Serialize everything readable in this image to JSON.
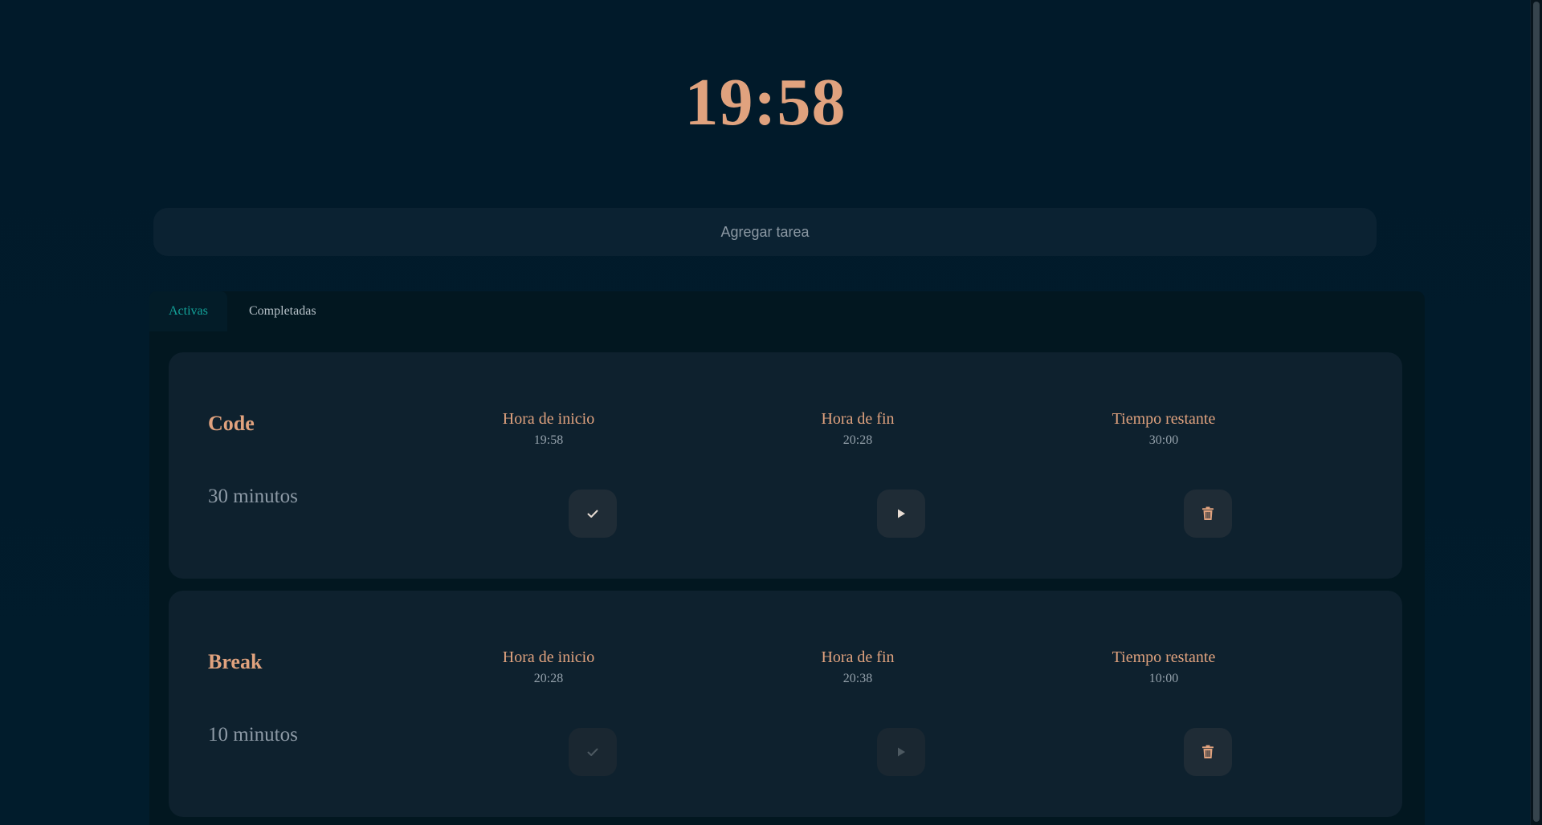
{
  "clock": "19:58",
  "add_task": {
    "placeholder": "Agregar tarea"
  },
  "tabs": [
    {
      "label": "Activas",
      "active": true
    },
    {
      "label": "Completadas",
      "active": false
    }
  ],
  "tasks": [
    {
      "name": "Code",
      "duration": "30 minutos",
      "start_label": "Hora de inicio",
      "start_value": "19:58",
      "end_label": "Hora de fin",
      "end_value": "20:28",
      "remaining_label": "Tiempo restante",
      "remaining_value": "30:00",
      "complete_enabled": true,
      "play_enabled": true
    },
    {
      "name": "Break",
      "duration": "10 minutos",
      "start_label": "Hora de inicio",
      "start_value": "20:28",
      "end_label": "Hora de fin",
      "end_value": "20:38",
      "remaining_label": "Tiempo restante",
      "remaining_value": "10:00",
      "complete_enabled": false,
      "play_enabled": false
    }
  ],
  "icons": {
    "complete": "check-icon",
    "play": "play-icon",
    "delete": "trash-icon"
  },
  "colors": {
    "background": "#011a2a",
    "accent": "#e0a27e",
    "active_tab": "#13a39a",
    "card": "#0e212e",
    "button": "#1f2c36"
  }
}
